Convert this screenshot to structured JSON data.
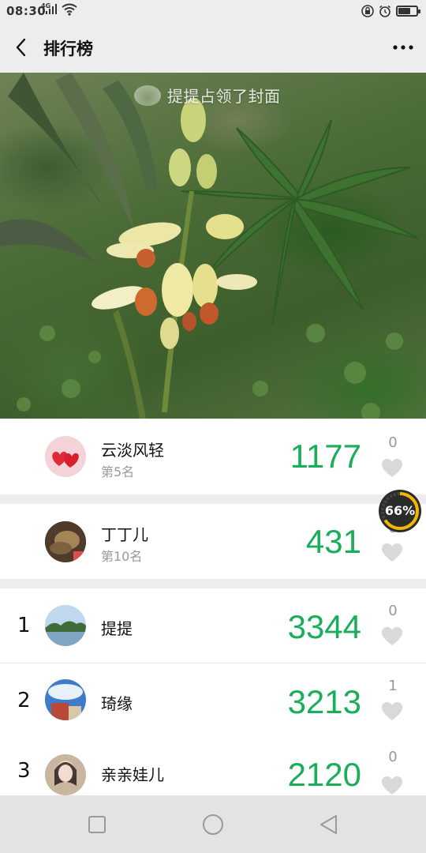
{
  "status_bar": {
    "time": "08:30",
    "network": "4G",
    "battery_level": 0.66
  },
  "header": {
    "title": "排行榜"
  },
  "cover": {
    "caption": "提提占领了封面"
  },
  "my_entry": {
    "name": "云淡风轻",
    "rank_label": "第5名",
    "steps": "1177",
    "likes": "0"
  },
  "friend_entry": {
    "name": "丁丁儿",
    "rank_label": "第10名",
    "steps": "431",
    "likes": "0"
  },
  "ranking": [
    {
      "rank": "1",
      "name": "提提",
      "steps": "3344",
      "likes": "0"
    },
    {
      "rank": "2",
      "name": "琦缘",
      "steps": "3213",
      "likes": "1"
    },
    {
      "rank": "3",
      "name": "亲亲娃儿",
      "steps": "2120",
      "likes": "0"
    }
  ],
  "progress_badge": {
    "value": 0.66,
    "label": "66%"
  },
  "colors": {
    "steps": "#1aad5a",
    "background": "#ededed",
    "badge_ring": "#f2b705"
  }
}
